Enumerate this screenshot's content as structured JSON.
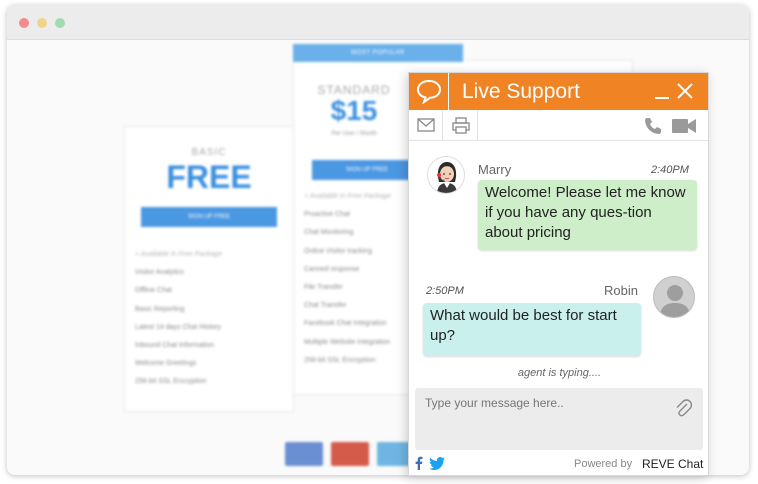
{
  "background_page": {
    "popular_label": "MOST POPULAR",
    "basic": {
      "name": "BASIC",
      "price": "FREE",
      "button": "SIGN UP FREE",
      "features": [
        "+ Available in Free Package",
        "Visitor Analytics",
        "Offline Chat",
        "Basic Reporting",
        "Latest 14 days Chat History",
        "Inbound Chat Information",
        "Welcome Greetings",
        "256-bit SSL Encryption"
      ]
    },
    "standard": {
      "name": "STANDARD",
      "price": "$15",
      "sub": "Per User / Month",
      "button": "SIGN UP FREE",
      "features": [
        "+ Available in Free Package",
        "Proactive Chat",
        "Chat Monitoring",
        "Online Visitor tracking",
        "Canned response",
        "File Transfer",
        "Chat Transfer",
        "Facebook Chat Integration",
        "Multiple Website Integration",
        "256-bit SSL Encryption"
      ]
    },
    "cards": [
      "VISA",
      "MasterCard",
      "AMEX"
    ]
  },
  "chat": {
    "title": "Live Support",
    "accent_color": "#f08424",
    "icons": {
      "logo": "chat-bubble-icon",
      "minimize": "minimize-icon",
      "close": "close-icon",
      "email": "envelope-icon",
      "print": "printer-icon",
      "call": "phone-icon",
      "video": "video-camera-icon",
      "attach": "paperclip-icon",
      "facebook": "facebook-icon",
      "twitter": "twitter-icon"
    },
    "messages": [
      {
        "sender": "Marry",
        "time": "2:40PM",
        "text": "Welcome! Please let me know if you have any ques-tion about pricing",
        "color": "#cdeec8"
      },
      {
        "sender": "Robin",
        "time": "2:50PM",
        "text": "What would be best for start up?",
        "color": "#c9f0ec"
      }
    ],
    "typing_status": "agent is typing....",
    "input": {
      "placeholder": "Type your message here..",
      "value": ""
    },
    "footer": {
      "powered_by": "Powered by",
      "brand": "REVE Chat"
    }
  }
}
